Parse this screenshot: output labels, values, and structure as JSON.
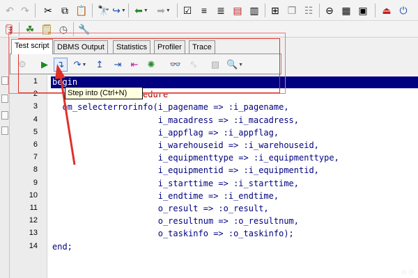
{
  "toolbar1": {
    "buttons": [
      {
        "name": "undo-icon",
        "glyph": "↶"
      },
      {
        "name": "redo-icon",
        "glyph": "↷"
      },
      {
        "name": "cut-icon",
        "glyph": "✂"
      },
      {
        "name": "copy-icon",
        "glyph": "⧉"
      },
      {
        "name": "paste-icon",
        "glyph": "📋"
      },
      {
        "name": "find-icon",
        "glyph": "🔭"
      },
      {
        "name": "find-next-icon",
        "glyph": "↪"
      },
      {
        "name": "back-icon",
        "glyph": "⬅"
      },
      {
        "name": "forward-icon",
        "glyph": "➡"
      },
      {
        "name": "checklist-icon",
        "glyph": "☑"
      },
      {
        "name": "indent-icon",
        "glyph": "≡"
      },
      {
        "name": "outdent-icon",
        "glyph": "≣"
      },
      {
        "name": "comment-icon",
        "glyph": "▤"
      },
      {
        "name": "uncomment-icon",
        "glyph": "▥"
      },
      {
        "name": "window-tile-icon",
        "glyph": "⊞"
      },
      {
        "name": "window-cascade-icon",
        "glyph": "❐"
      },
      {
        "name": "window-list-icon",
        "glyph": "☷"
      },
      {
        "name": "stop-icon",
        "glyph": "⊖"
      },
      {
        "name": "window-grid-icon",
        "glyph": "▦"
      },
      {
        "name": "layout-icon",
        "glyph": "▣"
      },
      {
        "name": "exit-icon",
        "glyph": "⏏"
      },
      {
        "name": "power-icon",
        "glyph": "⏻"
      }
    ]
  },
  "toolbar2": {
    "buttons": [
      {
        "name": "database-icon",
        "glyph": "🛢"
      },
      {
        "name": "connect-icon",
        "glyph": "☘"
      },
      {
        "name": "notes-icon",
        "glyph": "🗒"
      },
      {
        "name": "clock-icon",
        "glyph": "◷"
      },
      {
        "name": "wrench-icon",
        "glyph": "🔧"
      }
    ]
  },
  "tabs": [
    "Test script",
    "DBMS Output",
    "Statistics",
    "Profiler",
    "Trace"
  ],
  "debug_toolbar": [
    {
      "name": "breakpoints-icon",
      "glyph": "⚙"
    },
    {
      "name": "run-icon",
      "glyph": "▶"
    },
    {
      "name": "step-into-icon",
      "glyph": "↴"
    },
    {
      "name": "step-over-icon",
      "glyph": "↷"
    },
    {
      "name": "step-out-icon",
      "glyph": "↥"
    },
    {
      "name": "run-to-exception-icon",
      "glyph": "⇥"
    },
    {
      "name": "step-back-icon",
      "glyph": "⇤"
    },
    {
      "name": "toggle-icon",
      "glyph": "✺"
    },
    {
      "name": "watch-icon",
      "glyph": "👓"
    },
    {
      "name": "variables-icon",
      "glyph": "⁰₀"
    },
    {
      "name": "image-icon",
      "glyph": "▧"
    },
    {
      "name": "search-icon",
      "glyph": "🔍"
    }
  ],
  "tooltip": "Step into (Ctrl+N)",
  "line_numbers": [
    "1",
    "2",
    "3",
    "4",
    "5",
    "6",
    "7",
    "8",
    "9",
    "10",
    "11",
    "12",
    "13",
    "14"
  ],
  "code_lines": [
    "begin",
    "  -- Call the procedure",
    "  om_selecterrorinfo(i_pagename => :i_pagename,",
    "                     i_macadress => :i_macadress,",
    "                     i_appflag => :i_appflag,",
    "                     i_warehouseid => :i_warehouseid,",
    "                     i_equipmenttype => :i_equipmenttype,",
    "                     i_equipmentid => :i_equipmentid,",
    "                     i_starttime => :i_starttime,",
    "                     i_endtime => :i_endtime,",
    "                     o_result => :o_result,",
    "                     o_resultnum => :o_resultnum,",
    "                     o_taskinfo => :o_taskinfo);",
    "end;"
  ],
  "colors": {
    "keyword": "#000080",
    "comment": "#a80000",
    "selection": "#000080",
    "annotation": "#e0302a"
  }
}
